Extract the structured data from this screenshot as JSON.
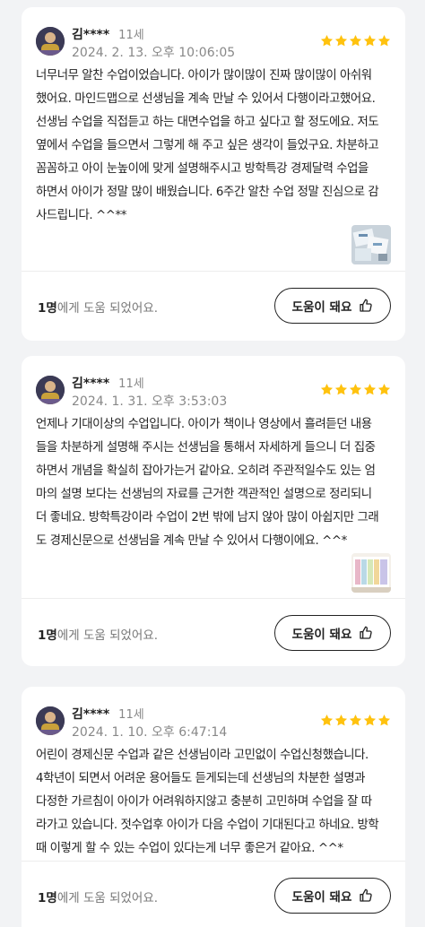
{
  "colors": {
    "star": "#FFC20E",
    "page_bg": "#F2F3F5",
    "card_bg": "#FFFFFF",
    "muted_text": "#888888"
  },
  "reviews": [
    {
      "name": "김****",
      "age": "11세",
      "date": "2024. 2. 13. 오후 10:06:05",
      "rating": 5,
      "text_lines": [
        "너무너무 알찬 수업이었습니다. 아이가 많이많이 진짜 많이많이 아쉬워",
        "했어요. 마인드맵으로 선생님을 계속 만날 수 있어서 다행이라고했어요.",
        "선생님 수업을 직접듣고 하는 대면수업을 하고 싶다고 할 정도에요. 저도",
        "옆에서 수업을 들으면서 그렇게 해 주고 싶은 생각이 들었구요. 차분하고",
        "꼼꼼하고 아이 눈높이에 맞게 설명해주시고 방학특강 경제달력 수업을",
        "하면서 아이가 정말 많이 배웠습니다. 6주간 알찬 수업 정말 진심으로 감",
        "사드립니다. ^^**"
      ],
      "helpful_count": "1명",
      "helpful_suffix": "에게 도움 되었어요.",
      "button_label": "도움이 돼요"
    },
    {
      "name": "김****",
      "age": "11세",
      "date": "2024. 1. 31. 오후 3:53:03",
      "rating": 5,
      "text_lines": [
        "언제나 기대이상의 수업입니다. 아이가 책이나 영상에서 흘려듣던 내용",
        "들을 차분하게 설명해 주시는 선생님을 통해서 자세하게 들으니 더 집중",
        "하면서 개념을 확실히 잡아가는거 같아요. 오히려 주관적일수도 있는 엄",
        "마의 설명 보다는 선생님의 자료를 근거한 객관적인 설명으로 정리되니",
        "더 좋네요. 방학특강이라 수업이 2번 밖에 남지 않아 많이 아쉽지만 그래",
        "도 경제신문으로 선생님을 계속 만날 수 있어서 다행이에요. ^^*"
      ],
      "helpful_count": "1명",
      "helpful_suffix": "에게 도움 되었어요.",
      "button_label": "도움이 돼요"
    },
    {
      "name": "김****",
      "age": "11세",
      "date": "2024. 1. 10. 오후 6:47:14",
      "rating": 5,
      "text_lines": [
        "어린이 경제신문 수업과 같은 선생님이라 고민없이 수업신청했습니다.",
        "4학년이 되면서 어려운 용어들도 듣게되는데 선생님의 차분한 설명과",
        "다정한 가르침이 아이가 어려워하지않고 충분히 고민하며 수업을 잘 따",
        "라가고 있습니다. 젓수업후 아이가 다음 수업이 기대된다고 하네요. 방학",
        "때 이렇게 할 수 있는 수업이 있다는게 너무 좋은거 같아요. ^^*"
      ],
      "helpful_count": "1명",
      "helpful_suffix": "에게 도움 되었어요.",
      "button_label": "도움이 돼요"
    }
  ]
}
